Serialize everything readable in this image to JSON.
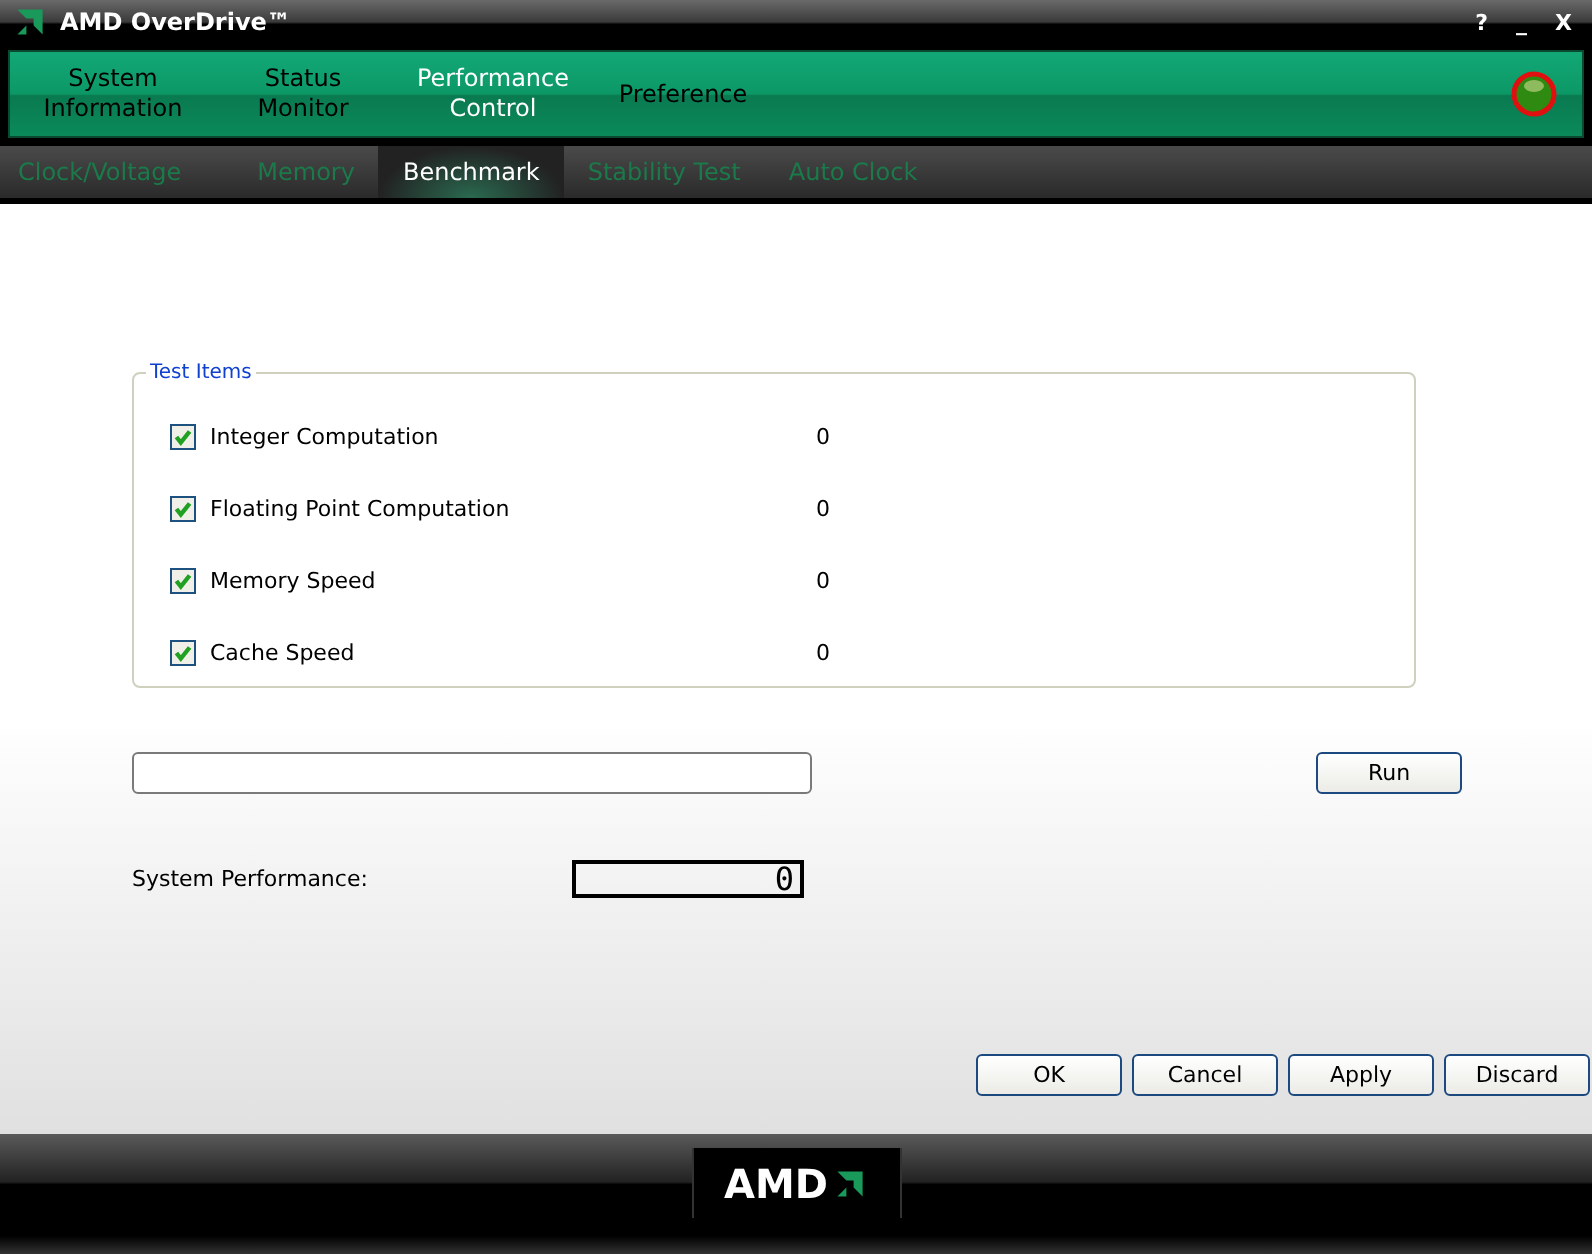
{
  "window": {
    "title": "AMD OverDrive™",
    "controls": [
      "?",
      "_",
      "X"
    ]
  },
  "main_tabs": [
    {
      "lines": [
        "System",
        "Information"
      ],
      "selected": false
    },
    {
      "lines": [
        "Status",
        "Monitor"
      ],
      "selected": false
    },
    {
      "lines": [
        "Performance",
        "Control"
      ],
      "selected": true
    },
    {
      "lines": [
        "Preference"
      ],
      "selected": false
    }
  ],
  "sub_tabs": [
    {
      "label": "Clock/Voltage",
      "selected": false
    },
    {
      "label": "Memory",
      "selected": false
    },
    {
      "label": "Benchmark",
      "selected": true
    },
    {
      "label": "Stability Test",
      "selected": false
    },
    {
      "label": "Auto Clock",
      "selected": false
    }
  ],
  "test_items": {
    "title": "Test Items",
    "items": [
      {
        "label": "Integer Computation",
        "checked": true,
        "value": "0"
      },
      {
        "label": "Floating Point Computation",
        "checked": true,
        "value": "0"
      },
      {
        "label": "Memory Speed",
        "checked": true,
        "value": "0"
      },
      {
        "label": "Cache Speed",
        "checked": true,
        "value": "0"
      }
    ]
  },
  "progress": {
    "level": 0
  },
  "run_button": "Run",
  "system_performance": {
    "label": "System Performance:",
    "value": "0"
  },
  "buttons": [
    "OK",
    "Cancel",
    "Apply",
    "Discard"
  ],
  "logo": {
    "text": "AMD"
  }
}
